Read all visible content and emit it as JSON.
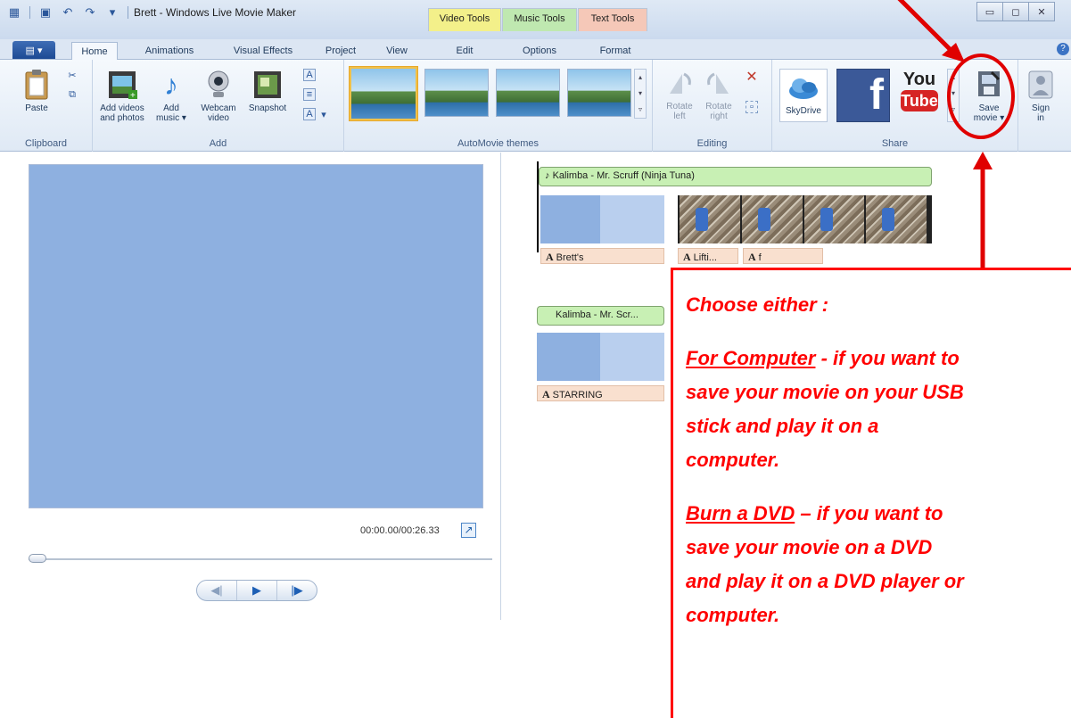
{
  "window": {
    "title": "Brett - Windows Live Movie Maker",
    "context_tabs": [
      {
        "label": "Video Tools",
        "color": "#f3f08a"
      },
      {
        "label": "Music Tools",
        "color": "#bfe8b0"
      },
      {
        "label": "Text Tools",
        "color": "#f5c8b8"
      }
    ],
    "controls": {
      "minimize": "▭",
      "maximize": "◻",
      "close": "✕"
    }
  },
  "tabs": [
    "Home",
    "Animations",
    "Visual Effects",
    "Project",
    "View",
    "Edit",
    "Options",
    "Format"
  ],
  "active_tab": "Home",
  "ribbon": {
    "clipboard": {
      "label": "Clipboard",
      "paste": "Paste"
    },
    "add": {
      "label": "Add",
      "add_videos_1": "Add videos",
      "add_videos_2": "and photos",
      "add_music_1": "Add",
      "add_music_2": "music ▾",
      "webcam_1": "Webcam",
      "webcam_2": "video",
      "snapshot": "Snapshot"
    },
    "themes": {
      "label": "AutoMovie themes"
    },
    "editing": {
      "label": "Editing",
      "rotate_left_1": "Rotate",
      "rotate_left_2": "left",
      "rotate_right_1": "Rotate",
      "rotate_right_2": "right"
    },
    "share": {
      "label": "Share",
      "skydrive": "SkyDrive",
      "youtube_1": "You",
      "youtube_2": "Tube",
      "facebook": "f",
      "save_movie_1": "Save",
      "save_movie_2": "movie ▾",
      "sign_in_1": "Sign",
      "sign_in_2": "in"
    }
  },
  "preview": {
    "timecode": "00:00.00/00:26.33",
    "screen_color": "#8eb0e0"
  },
  "storyboard": {
    "music_1": "Kalimba - Mr. Scruff (Ninja Tuna)",
    "music_2": "Kalimba - Mr. Scr...",
    "captions": [
      "Brett's",
      "Lifti...",
      "f",
      "STARRING"
    ],
    "clip_colors": [
      "#8eb0e0",
      "#b9cfee"
    ]
  },
  "annotation": {
    "color": "#ff0000",
    "heading": "Choose either :",
    "option1_title": "For Computer",
    "option1_lines": [
      " - if you want to",
      "save your movie on your USB",
      "stick and play it on a",
      "computer."
    ],
    "option2_title": "Burn a DVD",
    "option2_lines": [
      " – if you want to",
      "save your movie on a DVD",
      "and play it on a DVD player or",
      "computer."
    ]
  }
}
